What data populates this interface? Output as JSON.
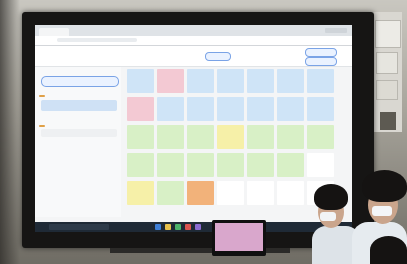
{
  "screen": {
    "header_title": "",
    "sidebar_button": "",
    "cells": [
      {
        "color": "#cfe4f7"
      },
      {
        "color": "#f3c9d3"
      },
      {
        "color": "#cfe4f7"
      },
      {
        "color": "#cfe4f7"
      },
      {
        "color": "#cfe4f7"
      },
      {
        "color": "#cfe4f7"
      },
      {
        "color": "#cfe4f7"
      },
      {
        "color": "#f3c9d3"
      },
      {
        "color": "#cfe4f7"
      },
      {
        "color": "#cfe4f7"
      },
      {
        "color": "#cfe4f7"
      },
      {
        "color": "#cfe4f7"
      },
      {
        "color": "#cfe4f7"
      },
      {
        "color": "#cfe4f7"
      },
      {
        "color": "#d8f0c6"
      },
      {
        "color": "#d8f0c6"
      },
      {
        "color": "#d8f0c6"
      },
      {
        "color": "#f6f0a8"
      },
      {
        "color": "#d8f0c6"
      },
      {
        "color": "#d8f0c6"
      },
      {
        "color": "#d8f0c6"
      },
      {
        "color": "#d8f0c6"
      },
      {
        "color": "#d8f0c6"
      },
      {
        "color": "#d8f0c6"
      },
      {
        "color": "#d8f0c6"
      },
      {
        "color": "#d8f0c6"
      },
      {
        "color": "#d8f0c6"
      },
      {
        "color": "#ffffff"
      },
      {
        "color": "#f6f0a8"
      },
      {
        "color": "#d8f0c6"
      },
      {
        "color": "#f2b27a"
      },
      {
        "color": "#ffffff"
      },
      {
        "color": "#ffffff"
      },
      {
        "color": "#ffffff"
      },
      {
        "color": "#ffffff"
      }
    ]
  },
  "colors": {
    "board": "#161514",
    "screen_bg": "#f4f5f6",
    "accent": "#2f6fd6",
    "taskbar": "#1f2a36"
  }
}
